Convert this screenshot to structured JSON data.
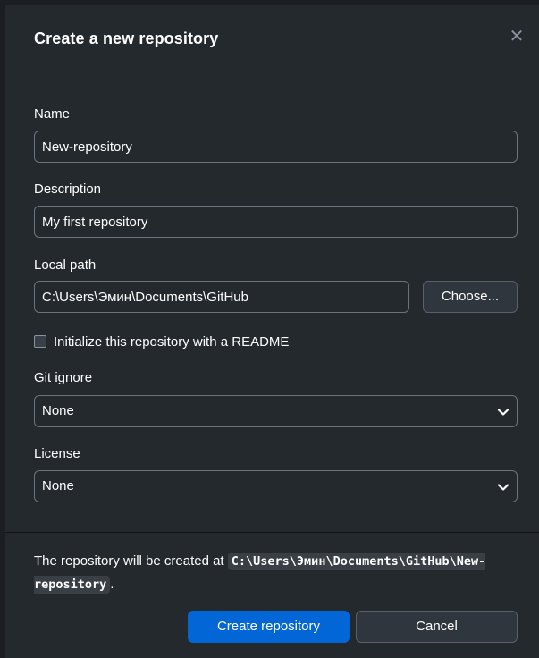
{
  "dialog": {
    "title": "Create a new repository",
    "close_glyph": "✕"
  },
  "form": {
    "name": {
      "label": "Name",
      "value": "New-repository"
    },
    "description": {
      "label": "Description",
      "value": "My first repository"
    },
    "local_path": {
      "label": "Local path",
      "value": "C:\\Users\\Эмин\\Documents\\GitHub",
      "choose_label": "Choose..."
    },
    "readme": {
      "label": "Initialize this repository with a README",
      "checked": false
    },
    "git_ignore": {
      "label": "Git ignore",
      "selected": "None"
    },
    "license": {
      "label": "License",
      "selected": "None"
    }
  },
  "footer": {
    "text_before": "The repository will be created at ",
    "path": "C:\\Users\\Эмин\\Documents\\GitHub\\New-repository",
    "text_after": ".",
    "create_label": "Create repository",
    "cancel_label": "Cancel"
  },
  "colors": {
    "background": "#24292e",
    "primary_button": "#0366d6",
    "border": "#6a737d"
  }
}
